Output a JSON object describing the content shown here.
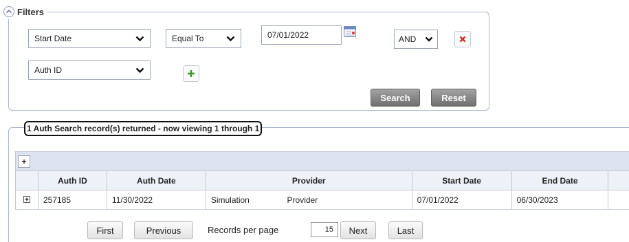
{
  "filters": {
    "legend": "Filters",
    "row1": {
      "field": "Start Date",
      "operator": "Equal To",
      "date_value": "07/01/2022",
      "conjunction": "AND"
    },
    "row2": {
      "field": "Auth ID"
    },
    "search_label": "Search",
    "reset_label": "Reset"
  },
  "results": {
    "summary": "1 Auth Search record(s) returned - now viewing 1 through 1",
    "toolbar_plus": "+",
    "columns": [
      "Auth ID",
      "Auth Date",
      "Provider",
      "Start Date",
      "End Date"
    ],
    "rows": [
      {
        "auth_id": "257185",
        "auth_date": "11/30/2022",
        "provider_first": "Simulation",
        "provider_last": "Provider",
        "start_date": "07/01/2022",
        "end_date": "06/30/2023"
      }
    ]
  },
  "pager": {
    "first": "First",
    "previous": "Previous",
    "records_per_page_label": "Records per page",
    "records_per_page": "15",
    "next": "Next",
    "last": "Last"
  },
  "colors": {
    "border": "#aab5cf",
    "remove_red": "#d62828",
    "add_green": "#3c9a2e",
    "header_bg": "#eef1f8",
    "toolbar_bg": "#dde3f1"
  },
  "icons": {
    "collapse": "chevron-up-circle-icon",
    "calendar": "calendar-icon",
    "remove": "close-icon",
    "add": "plus-icon",
    "expand": "plus-square-icon"
  }
}
